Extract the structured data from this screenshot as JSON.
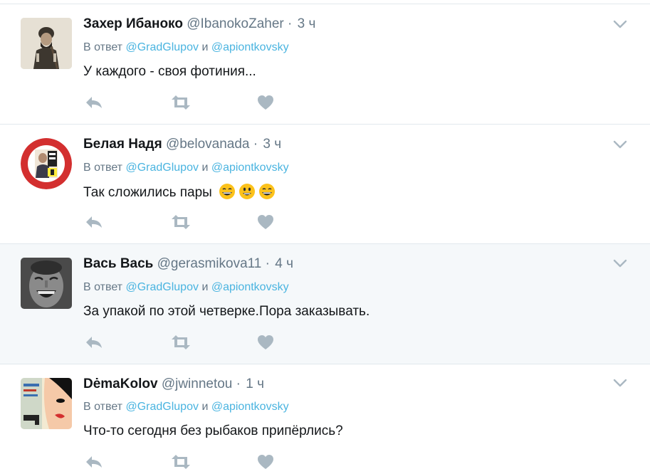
{
  "tweets": [
    {
      "name": "Захер Ибаноко",
      "handle": "@IbanokoZaher",
      "separator": "·",
      "time": "3 ч",
      "reply_prefix": "В ответ",
      "reply_user1": "@GradGlupov",
      "reply_and": "и",
      "reply_user2": "@apiontkovsky",
      "text": "У каждого - своя фотиния...",
      "avatar_icon": "man-with-rifle-photo"
    },
    {
      "name": "Белая Надя",
      "handle": "@belovanada",
      "separator": "·",
      "time": "3 ч",
      "reply_prefix": "В ответ",
      "reply_user1": "@GradGlupov",
      "reply_and": "и",
      "reply_user2": "@apiontkovsky",
      "text": "Так сложились пары",
      "emojis": [
        "grinning-face",
        "smiling-face",
        "grinning-face"
      ],
      "avatar_icon": "party-badge-logo"
    },
    {
      "name": "Вась Вась",
      "handle": "@gerasmikova11",
      "separator": "·",
      "time": "4 ч",
      "reply_prefix": "В ответ",
      "reply_user1": "@GradGlupov",
      "reply_and": "и",
      "reply_user2": "@apiontkovsky",
      "text": "За упакой по этой четверке.Пора заказывать.",
      "avatar_icon": "laughing-man-photo"
    },
    {
      "name": "DėmaKolov",
      "handle": "@jwinnetou",
      "separator": "·",
      "time": "1 ч",
      "reply_prefix": "В ответ",
      "reply_user1": "@GradGlupov",
      "reply_and": "и",
      "reply_user2": "@apiontkovsky",
      "text": "Что-то сегодня без рыбаков припёрлись?",
      "avatar_icon": "pop-art-comic-photo"
    }
  ],
  "colors": {
    "link": "#4ab4e0",
    "muted": "#657786",
    "icon": "#aab8c2",
    "highlight_bg": "#f5f8fa"
  },
  "icons": [
    "reply-icon",
    "retweet-icon",
    "like-icon",
    "chevron-down-icon"
  ]
}
